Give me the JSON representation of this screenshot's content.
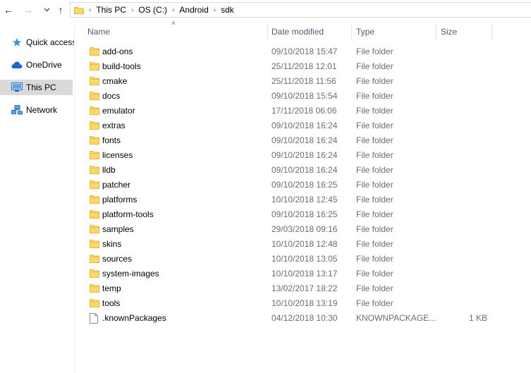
{
  "navigation": {
    "back_glyph": "←",
    "forward_glyph": "→",
    "recent_glyph": "⌄",
    "up_glyph": "↑"
  },
  "breadcrumb": [
    "This PC",
    "OS (C:)",
    "Android",
    "sdk"
  ],
  "sidebar": {
    "items": [
      {
        "label": "Quick access",
        "icon": "star-icon"
      },
      {
        "label": "OneDrive",
        "icon": "cloud-icon"
      },
      {
        "label": "This PC",
        "icon": "computer-icon",
        "selected": true
      },
      {
        "label": "Network",
        "icon": "network-icon"
      }
    ]
  },
  "columns": {
    "name": "Name",
    "date_modified": "Date modified",
    "type": "Type",
    "size": "Size"
  },
  "files": [
    {
      "name": "add-ons",
      "date": "09/10/2018 15:47",
      "type": "File folder",
      "size": "",
      "kind": "folder"
    },
    {
      "name": "build-tools",
      "date": "25/11/2018 12:01",
      "type": "File folder",
      "size": "",
      "kind": "folder"
    },
    {
      "name": "cmake",
      "date": "25/11/2018 11:56",
      "type": "File folder",
      "size": "",
      "kind": "folder"
    },
    {
      "name": "docs",
      "date": "09/10/2018 15:54",
      "type": "File folder",
      "size": "",
      "kind": "folder"
    },
    {
      "name": "emulator",
      "date": "17/11/2018 06:06",
      "type": "File folder",
      "size": "",
      "kind": "folder"
    },
    {
      "name": "extras",
      "date": "09/10/2018 16:24",
      "type": "File folder",
      "size": "",
      "kind": "folder"
    },
    {
      "name": "fonts",
      "date": "09/10/2018 16:24",
      "type": "File folder",
      "size": "",
      "kind": "folder"
    },
    {
      "name": "licenses",
      "date": "09/10/2018 16:24",
      "type": "File folder",
      "size": "",
      "kind": "folder"
    },
    {
      "name": "lldb",
      "date": "09/10/2018 16:24",
      "type": "File folder",
      "size": "",
      "kind": "folder"
    },
    {
      "name": "patcher",
      "date": "09/10/2018 16:25",
      "type": "File folder",
      "size": "",
      "kind": "folder"
    },
    {
      "name": "platforms",
      "date": "10/10/2018 12:45",
      "type": "File folder",
      "size": "",
      "kind": "folder"
    },
    {
      "name": "platform-tools",
      "date": "09/10/2018 16:25",
      "type": "File folder",
      "size": "",
      "kind": "folder"
    },
    {
      "name": "samples",
      "date": "29/03/2018 09:16",
      "type": "File folder",
      "size": "",
      "kind": "folder"
    },
    {
      "name": "skins",
      "date": "10/10/2018 12:48",
      "type": "File folder",
      "size": "",
      "kind": "folder"
    },
    {
      "name": "sources",
      "date": "10/10/2018 13:05",
      "type": "File folder",
      "size": "",
      "kind": "folder"
    },
    {
      "name": "system-images",
      "date": "10/10/2018 13:17",
      "type": "File folder",
      "size": "",
      "kind": "folder"
    },
    {
      "name": "temp",
      "date": "13/02/2017 18:22",
      "type": "File folder",
      "size": "",
      "kind": "folder"
    },
    {
      "name": "tools",
      "date": "10/10/2018 13:19",
      "type": "File folder",
      "size": "",
      "kind": "folder"
    },
    {
      "name": ".knownPackages",
      "date": "04/12/2018 10:30",
      "type": "KNOWNPACKAGE...",
      "size": "1 KB",
      "kind": "file"
    }
  ],
  "colors": {
    "folder_fill": "#ffd767",
    "folder_edge": "#e0b94a",
    "header_text": "#4c607a",
    "secondary_text": "#6d6d6d",
    "selected_bg": "#d9d9d9"
  }
}
